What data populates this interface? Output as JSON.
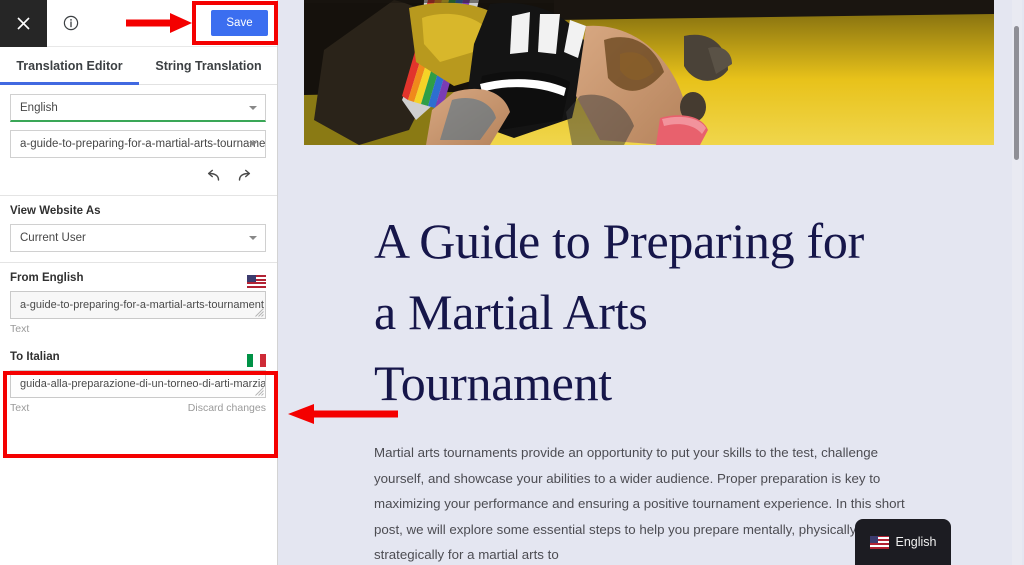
{
  "sidebar": {
    "topbar": {
      "close_icon": "close-icon",
      "info_icon": "info-icon",
      "save_label": "Save"
    },
    "tabs": [
      {
        "label": "Translation Editor",
        "active": true
      },
      {
        "label": "String Translation",
        "active": false
      }
    ],
    "language_select": {
      "value": "English",
      "caret_icon": "chevron-down-icon"
    },
    "slug_select": {
      "value": "a-guide-to-preparing-for-a-martial-arts-tournament",
      "caret_icon": "chevron-down-icon"
    },
    "history": {
      "undo_icon": "undo-icon",
      "redo_icon": "redo-icon"
    },
    "view_website_as": {
      "title": "View Website As",
      "value": "Current User",
      "caret_icon": "chevron-down-icon"
    },
    "source": {
      "title": "From English",
      "flag_icon": "flag-us-icon",
      "value": "a-guide-to-preparing-for-a-martial-arts-tournament",
      "meta_label": "Text",
      "resize_icon": "resize-grip-icon"
    },
    "target": {
      "title": "To Italian",
      "flag_icon": "flag-it-icon",
      "value": "guida-alla-preparazione-di-un-torneo-di-arti-marziali",
      "meta_label": "Text",
      "discard_label": "Discard changes",
      "resize_icon": "resize-grip-icon"
    }
  },
  "main": {
    "hero_image_alt": "martial-arts-fighter-photo",
    "post_title": "A Guide to Preparing for a Martial Arts Tournament",
    "post_body": "Martial arts tournaments provide an opportunity to put your skills to the test, challenge yourself, and showcase your abilities to a wider audience. Proper preparation is key to maximizing your performance and ensuring a positive tournament experience. In this short post, we will explore some essential steps to help you prepare mentally, physically, and strategically for a martial arts to",
    "language_switcher": {
      "label": "English",
      "flag_icon": "flag-us-icon"
    }
  },
  "annotations": {
    "save_highlight": "save-button-highlight",
    "italian_highlight": "to-italian-highlight",
    "arrow_to_save": "arrow-pointing-right-to-save",
    "arrow_to_italian": "arrow-pointing-left-to-italian"
  },
  "colors": {
    "accent_blue": "#3b6ef0",
    "tab_underline": "#4169e1",
    "annotation_red": "#f40000",
    "page_background": "#e4e6f1",
    "title_navy": "#16164a",
    "select_green": "#3aa757"
  }
}
